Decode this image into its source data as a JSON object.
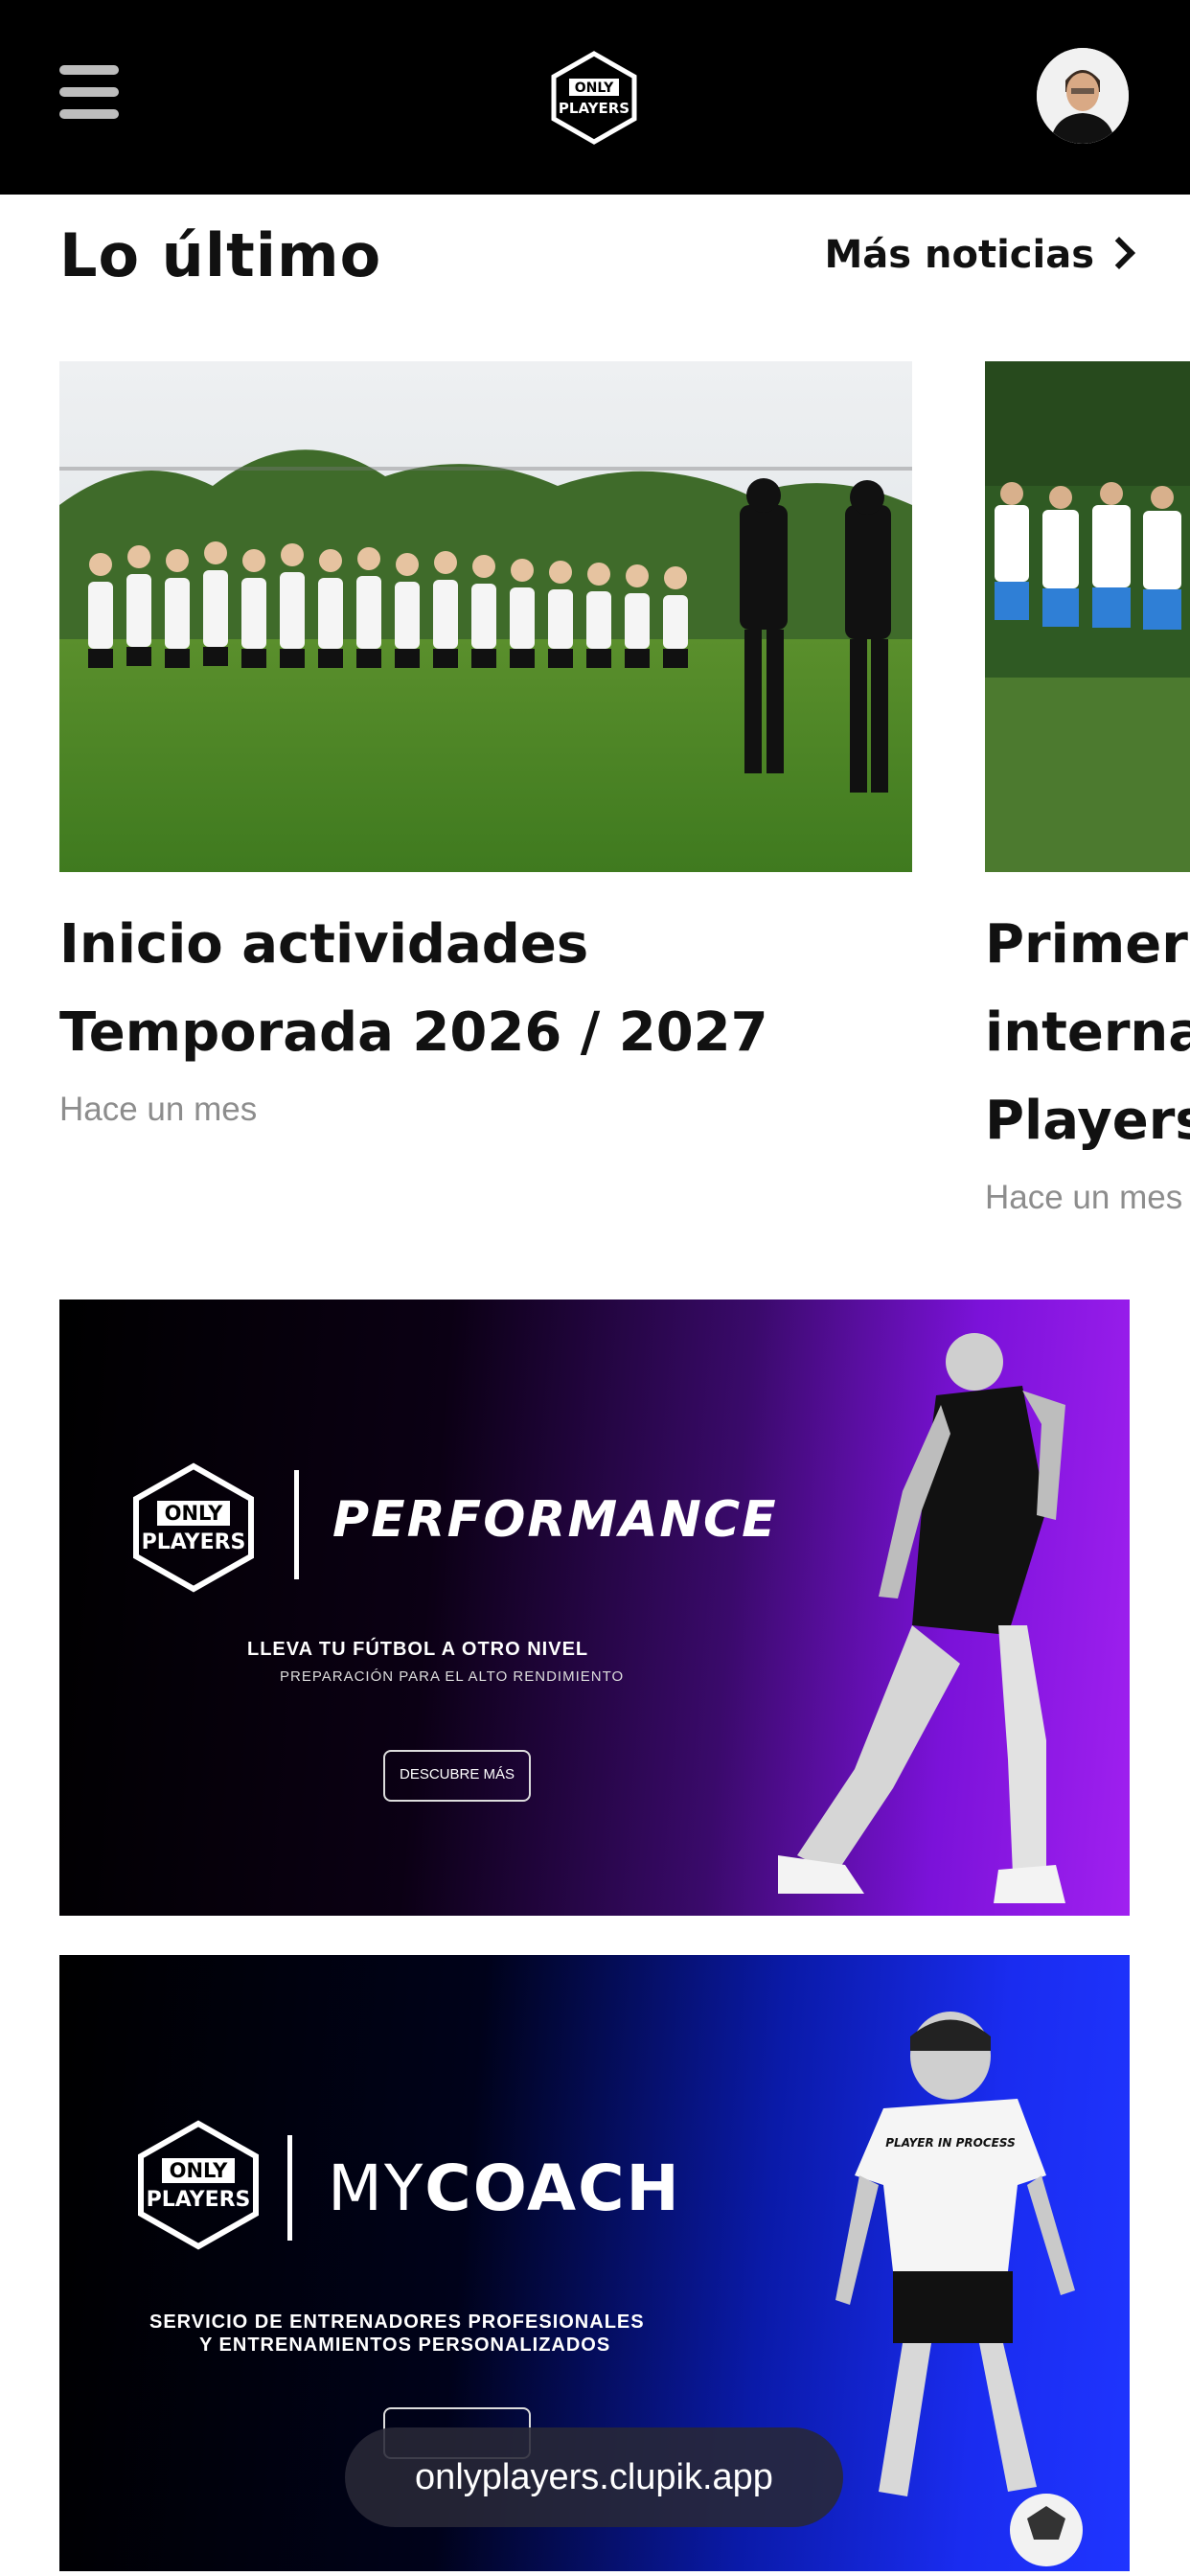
{
  "header": {
    "logo_text_top": "ONLY",
    "logo_text_bottom": "PLAYERS",
    "avatar": "user-avatar"
  },
  "section": {
    "title": "Lo último",
    "more_label": "Más noticias"
  },
  "news": [
    {
      "title_line1": "Inicio actividades",
      "title_line2": "Temporada 2026 / 2027",
      "time": "Hace un mes"
    },
    {
      "title_line1": "Primer",
      "title_line2": "interna",
      "title_line3": "Players",
      "time": "Hace un mes"
    }
  ],
  "banners": [
    {
      "logo_top": "ONLY",
      "logo_bottom": "PLAYERS",
      "title": "PERFORMANCE",
      "subtitle": "LLEVA TU FÚTBOL A OTRO NIVEL",
      "subtitle2": "PREPARACIÓN PARA EL ALTO RENDIMIENTO",
      "button": "DESCUBRE MÁS",
      "accent": "#a020f0"
    },
    {
      "logo_top": "ONLY",
      "logo_bottom": "PLAYERS",
      "title_light": "MY",
      "title_bold": "COACH",
      "subtitle": "SERVICIO DE ENTRENADORES PROFESIONALES",
      "subtitle2": "Y ENTRENAMIENTOS PERSONALIZADOS",
      "player_shirt": "PLAYER IN PROCESS",
      "accent": "#1f35ff"
    }
  ],
  "browser": {
    "url": "onlyplayers.clupik.app"
  }
}
